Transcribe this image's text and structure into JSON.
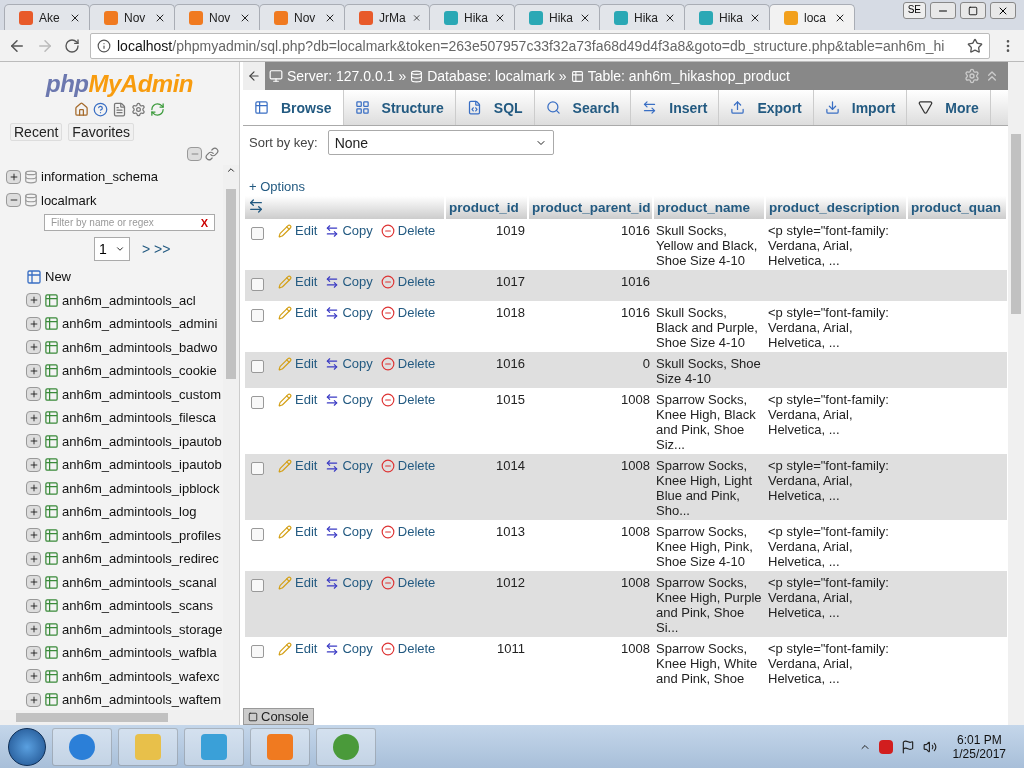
{
  "browser": {
    "tabs": [
      {
        "title": "Ake",
        "kind": "joomla",
        "selected": false
      },
      {
        "title": "Nov",
        "kind": "xampp",
        "selected": false
      },
      {
        "title": "Nov",
        "kind": "xampp",
        "selected": false
      },
      {
        "title": "Nov",
        "kind": "xampp",
        "selected": false
      },
      {
        "title": "JrMa",
        "kind": "joomla",
        "selected": false
      },
      {
        "title": "Hika",
        "kind": "hika",
        "selected": false
      },
      {
        "title": "Hika",
        "kind": "hika",
        "selected": false
      },
      {
        "title": "Hika",
        "kind": "hika",
        "selected": false
      },
      {
        "title": "Hika",
        "kind": "hika",
        "selected": false
      },
      {
        "title": "loca",
        "kind": "pma",
        "selected": true
      }
    ],
    "profile": "SE",
    "url_host": "localhost",
    "url_path": "/phpmyadmin/sql.php?db=localmark&token=263e507957c33f32a73fa68d49d4f3a8&goto=db_structure.php&table=anh6m_hi"
  },
  "sidebar": {
    "logo": {
      "prefix": "php",
      "name": "MyAdmin"
    },
    "buttons": [
      "Recent",
      "Favorites"
    ],
    "databases": [
      {
        "name": "information_schema",
        "expanded": false
      },
      {
        "name": "localmark",
        "expanded": true,
        "filter_placeholder": "Filter by name or regex",
        "clear": "X",
        "page": "1",
        "page_nav": "> >>",
        "new_label": "New",
        "children": [
          {
            "name": "anh6m_admintools_acl"
          },
          {
            "name": "anh6m_admintools_admini"
          },
          {
            "name": "anh6m_admintools_badwo"
          },
          {
            "name": "anh6m_admintools_cookie"
          },
          {
            "name": "anh6m_admintools_custom"
          },
          {
            "name": "anh6m_admintools_filesca"
          },
          {
            "name": "anh6m_admintools_ipautob"
          },
          {
            "name": "anh6m_admintools_ipautob"
          },
          {
            "name": "anh6m_admintools_ipblock"
          },
          {
            "name": "anh6m_admintools_log"
          },
          {
            "name": "anh6m_admintools_profiles"
          },
          {
            "name": "anh6m_admintools_redirec"
          },
          {
            "name": "anh6m_admintools_scanal"
          },
          {
            "name": "anh6m_admintools_scans"
          },
          {
            "name": "anh6m_admintools_storage"
          },
          {
            "name": "anh6m_admintools_wafbla"
          },
          {
            "name": "anh6m_admintools_wafexc"
          },
          {
            "name": "anh6m_admintools_waftem"
          }
        ]
      }
    ]
  },
  "breadcrumb": {
    "server": "Server: 127.0.0.1",
    "sep": "»",
    "database": "Database: localmark",
    "table": "Table: anh6m_hikashop_product"
  },
  "tabs": [
    {
      "label": "Browse",
      "kind": "browse",
      "selected": true
    },
    {
      "label": "Structure",
      "kind": "structure",
      "selected": false
    },
    {
      "label": "SQL",
      "kind": "sql",
      "selected": false
    },
    {
      "label": "Search",
      "kind": "search",
      "selected": false
    },
    {
      "label": "Insert",
      "kind": "insert",
      "selected": false
    },
    {
      "label": "Export",
      "kind": "export",
      "selected": false
    },
    {
      "label": "Import",
      "kind": "import",
      "selected": false
    },
    {
      "label": "More",
      "kind": "more",
      "selected": false
    }
  ],
  "sort": {
    "label": "Sort by key:",
    "value": "None"
  },
  "options_link": "+ Options",
  "table": {
    "columns": [
      "product_id",
      "product_parent_id",
      "product_name",
      "product_description",
      "product_quan"
    ],
    "rows": [
      {
        "checked": false,
        "actions": [
          "Edit",
          "Copy",
          "Delete"
        ],
        "product_id": "1019",
        "product_parent_id": "1016",
        "product_name": "Skull Socks, Yellow and Black, Shoe Size 4-10",
        "product_description": "<p style=\"font-family: Verdana, Arial, Helvetica, ..."
      },
      {
        "checked": false,
        "actions": [
          "Edit",
          "Copy",
          "Delete"
        ],
        "product_id": "1017",
        "product_parent_id": "1016",
        "product_name": "",
        "product_description": ""
      },
      {
        "checked": false,
        "actions": [
          "Edit",
          "Copy",
          "Delete"
        ],
        "product_id": "1018",
        "product_parent_id": "1016",
        "product_name": "Skull Socks, Black and Purple, Shoe Size 4-10",
        "product_description": "<p style=\"font-family: Verdana, Arial, Helvetica, ..."
      },
      {
        "checked": false,
        "actions": [
          "Edit",
          "Copy",
          "Delete"
        ],
        "product_id": "1016",
        "product_parent_id": "0",
        "product_name": "Skull Socks, Shoe Size 4-10",
        "product_description": ""
      },
      {
        "checked": false,
        "actions": [
          "Edit",
          "Copy",
          "Delete"
        ],
        "product_id": "1015",
        "product_parent_id": "1008",
        "product_name": "Sparrow Socks, Knee High, Black and Pink, Shoe Siz...",
        "product_description": "<p style=\"font-family: Verdana, Arial, Helvetica, ..."
      },
      {
        "checked": false,
        "actions": [
          "Edit",
          "Copy",
          "Delete"
        ],
        "product_id": "1014",
        "product_parent_id": "1008",
        "product_name": "Sparrow Socks, Knee High, Light Blue and Pink, Sho...",
        "product_description": "<p style=\"font-family: Verdana, Arial, Helvetica, ..."
      },
      {
        "checked": false,
        "actions": [
          "Edit",
          "Copy",
          "Delete"
        ],
        "product_id": "1013",
        "product_parent_id": "1008",
        "product_name": "Sparrow Socks, Knee High, Pink, Shoe Size 4-10",
        "product_description": "<p style=\"font-family: Verdana, Arial, Helvetica, ..."
      },
      {
        "checked": false,
        "actions": [
          "Edit",
          "Copy",
          "Delete"
        ],
        "product_id": "1012",
        "product_parent_id": "1008",
        "product_name": "Sparrow Socks, Knee High, Purple and Pink, Shoe Si...",
        "product_description": "<p style=\"font-family: Verdana, Arial, Helvetica, ..."
      },
      {
        "checked": false,
        "actions": [
          "Edit",
          "Copy",
          "Delete"
        ],
        "product_id": "1011",
        "product_parent_id": "1008",
        "product_name": "Sparrow Socks, Knee High, White and Pink, Shoe",
        "product_description": "<p style=\"font-family: Verdana, Arial, Helvetica, ..."
      }
    ]
  },
  "console": "Console",
  "taskbar": {
    "time": "6:01 PM",
    "date": "1/25/2017"
  }
}
